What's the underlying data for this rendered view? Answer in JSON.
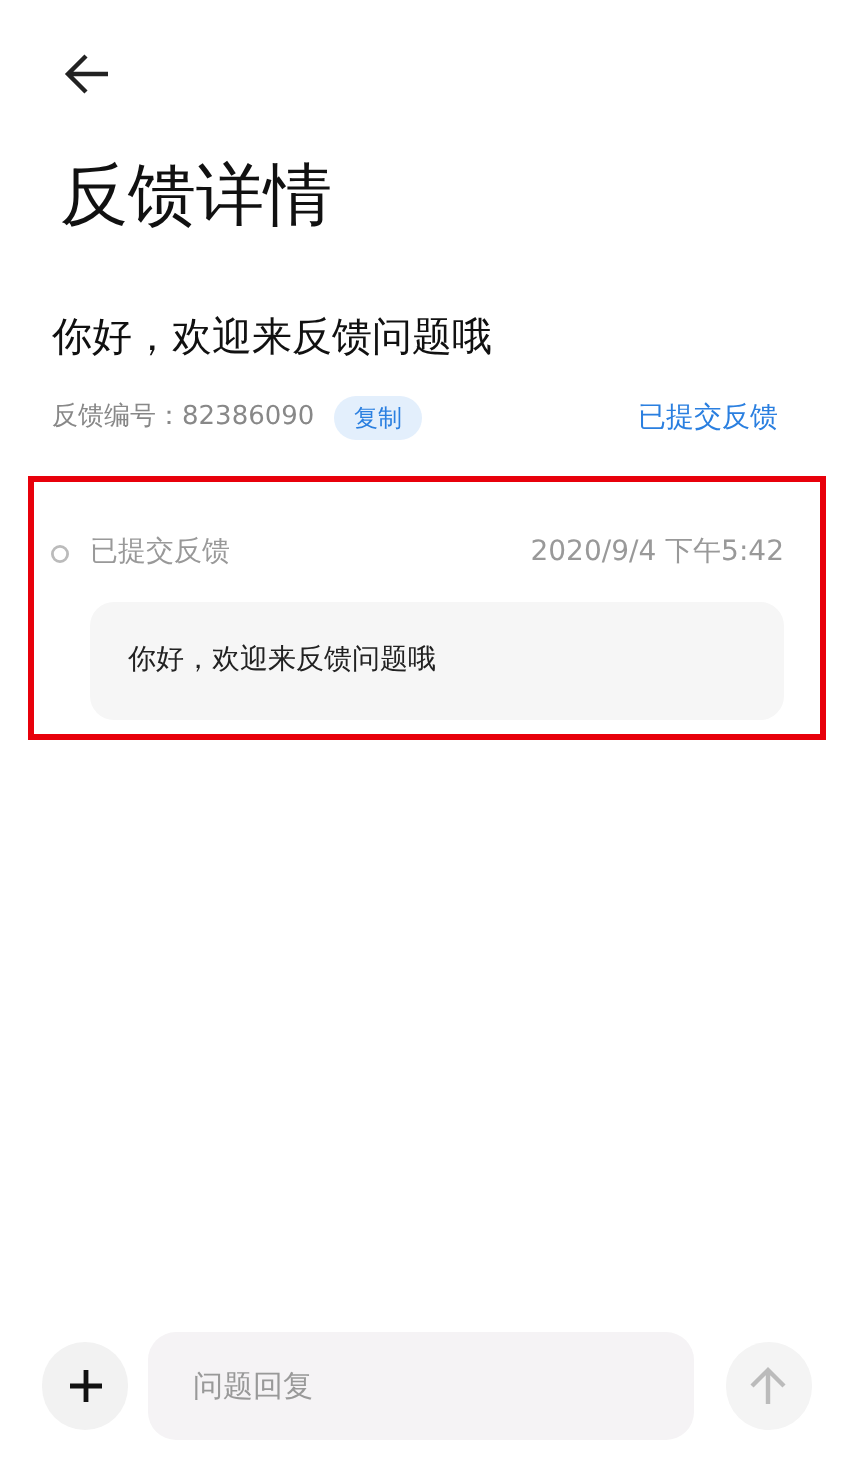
{
  "page": {
    "title": "反馈详情"
  },
  "feedback": {
    "subject": "你好，欢迎来反馈问题哦",
    "number_label": "反馈编号：82386090",
    "copy_button": "复制",
    "status": "已提交反馈"
  },
  "timeline": [
    {
      "status": "已提交反馈",
      "time": "2020/9/4 下午5:42",
      "message": "你好，欢迎来反馈问题哦",
      "highlighted": true
    }
  ],
  "reply": {
    "placeholder": "问题回复"
  }
}
